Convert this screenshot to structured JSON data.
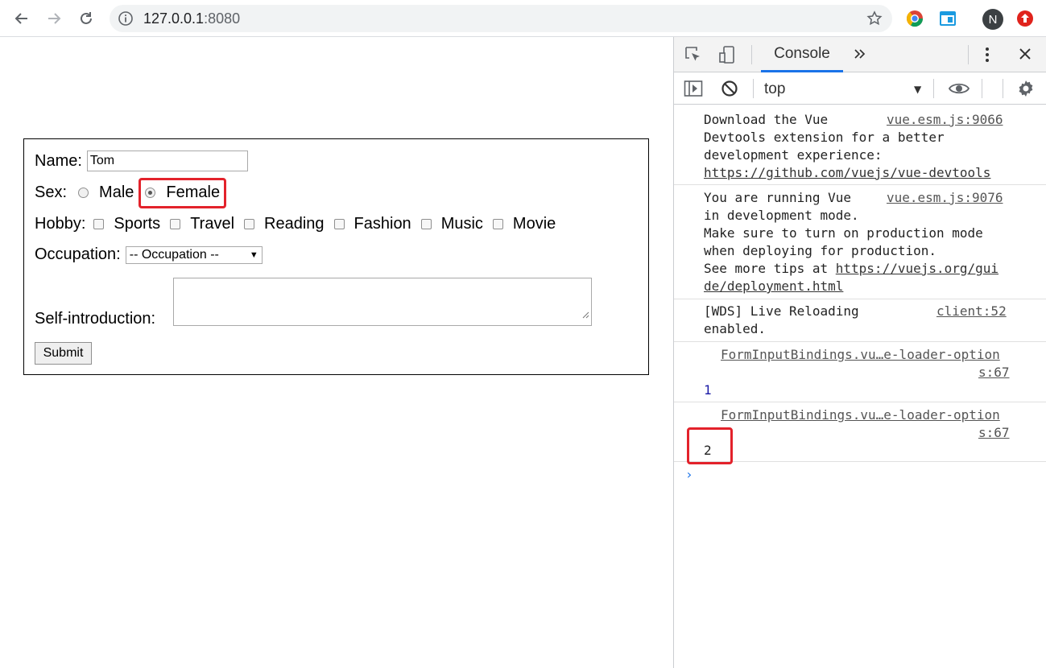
{
  "browser": {
    "url_host": "127.0.0.1",
    "url_port": ":8080",
    "profile_initial": "N",
    "icons": [
      "back-arrow-icon",
      "forward-arrow-icon",
      "reload-icon",
      "info-icon",
      "star-icon",
      "chrome-extension-icon",
      "window-extension-icon",
      "profile-avatar",
      "update-icon"
    ]
  },
  "form": {
    "name_label": "Name:",
    "name_value": "Tom",
    "sex_label": "Sex:",
    "sex_options": [
      "Male",
      "Female"
    ],
    "sex_selected": "Female",
    "hobby_label": "Hobby:",
    "hobbies": [
      "Sports",
      "Travel",
      "Reading",
      "Fashion",
      "Music",
      "Movie"
    ],
    "occupation_label": "Occupation:",
    "occupation_selected": "-- Occupation --",
    "intro_label": "Self-introduction:",
    "submit_label": "Submit"
  },
  "devtools": {
    "tab_console": "Console",
    "context": "top",
    "messages": [
      {
        "lines": [
          "Download the Vue",
          "Devtools extension for a better",
          "development experience:",
          "https://github.com/vuejs/vue-devtools"
        ],
        "source": "vue.esm.js:9066"
      },
      {
        "lines": [
          "You are running Vue",
          "in development mode.",
          "Make sure to turn on production mode",
          "when deploying for production.",
          "See more tips at ",
          "https://vuejs.org/gui",
          "de/deployment.html"
        ],
        "source": "vue.esm.js:9076"
      },
      {
        "lines": [
          "[WDS] Live Reloading",
          "enabled."
        ],
        "source": "client:52"
      },
      {
        "source_lines": [
          "FormInputBindings.vu…e-loader-option",
          "s:67"
        ],
        "value": "1"
      },
      {
        "source_lines": [
          "FormInputBindings.vu…e-loader-option",
          "s:67"
        ],
        "value": "2"
      }
    ],
    "prompt": "›"
  },
  "colors": {
    "highlight": "#e3222b",
    "accent": "#1a73e8",
    "number": "#1a1aa6"
  }
}
